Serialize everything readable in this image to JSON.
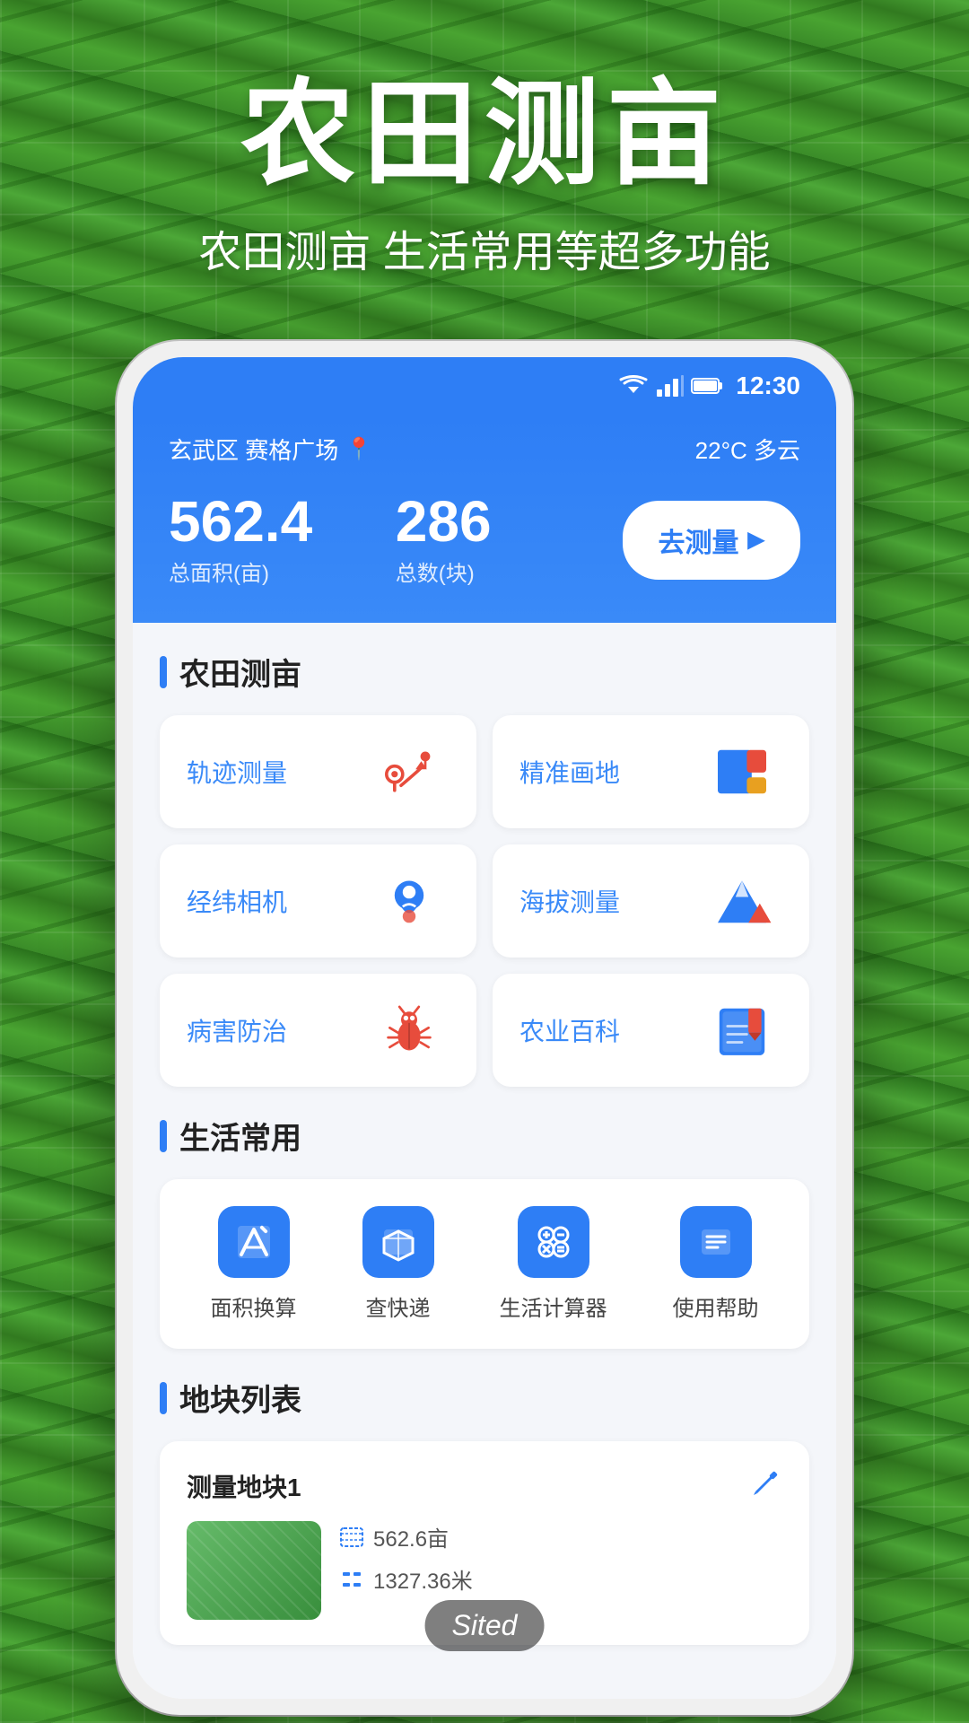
{
  "background": {
    "alt": "Aerial view of terraced green farmland"
  },
  "header": {
    "main_title": "农田测亩",
    "sub_title": "农田测亩 生活常用等超多功能"
  },
  "status_bar": {
    "time": "12:30",
    "wifi": "▼",
    "signal": "▲",
    "battery": "🔋"
  },
  "app_header": {
    "location": "玄武区 赛格广场",
    "weather": "22°C 多云",
    "total_area_value": "562.4",
    "total_area_label": "总面积(亩)",
    "total_count_value": "286",
    "total_count_label": "总数(块)",
    "measure_btn": "去测量"
  },
  "farmland_section": {
    "title": "农田测亩",
    "features": [
      {
        "id": "track",
        "label": "轨迹测量",
        "icon": "track-icon"
      },
      {
        "id": "precise",
        "label": "精准画地",
        "icon": "precise-icon"
      },
      {
        "id": "camera",
        "label": "经纬相机",
        "icon": "camera-icon"
      },
      {
        "id": "altitude",
        "label": "海拔测量",
        "icon": "altitude-icon"
      },
      {
        "id": "pest",
        "label": "病害防治",
        "icon": "pest-icon"
      },
      {
        "id": "agri",
        "label": "农业百科",
        "icon": "agri-icon"
      }
    ]
  },
  "life_section": {
    "title": "生活常用",
    "tools": [
      {
        "id": "area-convert",
        "label": "面积换算",
        "icon": "area-convert-icon"
      },
      {
        "id": "express",
        "label": "查快递",
        "icon": "express-icon"
      },
      {
        "id": "calculator",
        "label": "生活计算器",
        "icon": "calculator-icon"
      },
      {
        "id": "help",
        "label": "使用帮助",
        "icon": "help-icon"
      }
    ]
  },
  "land_list_section": {
    "title": "地块列表",
    "items": [
      {
        "name": "测量地块1",
        "area": "562.6亩",
        "perimeter": "1327.36米"
      }
    ]
  },
  "sited_badge": {
    "text": "Sited"
  }
}
